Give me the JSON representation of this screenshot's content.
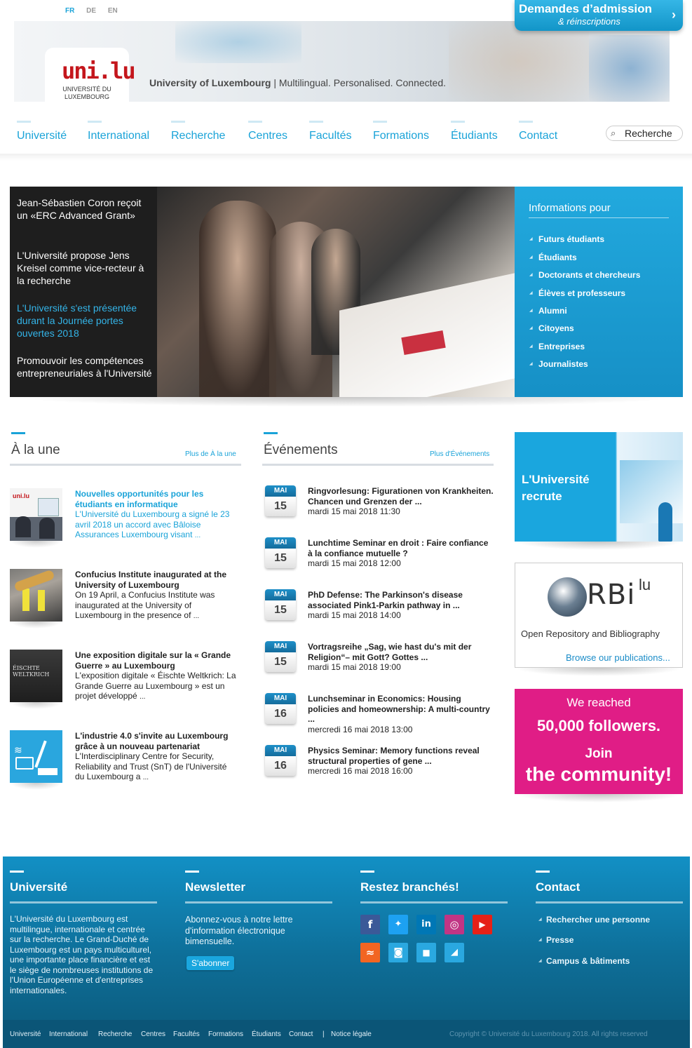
{
  "top": {
    "languages": [
      "FR",
      "DE",
      "EN"
    ],
    "active_language": "FR",
    "admission_line1": "Demandes d’admission",
    "admission_line2": "& réinscriptions",
    "admission_arrow": "›"
  },
  "brand": {
    "logo_mark": "uni.lu",
    "logo_sub": "UNIVERSITÉ DU LUXEMBOURG",
    "tagline_name": "University of Luxembourg",
    "tagline_rest": " | Multilingual. Personalised. Connected."
  },
  "nav": {
    "items": [
      "Université",
      "International",
      "Recherche",
      "Centres",
      "Facultés",
      "Formations",
      "Étudiants",
      "Contact"
    ],
    "search_value": "Recherche",
    "search_icon": "search-icon"
  },
  "slider": {
    "links": [
      "Jean-Sébastien Coron reçoit un «ERC Advanced Grant»",
      "L'Université propose Jens Kreisel comme vice-recteur à la recherche",
      "L'Université s'est présentée durant la Journée portes ouvertes 2018",
      "Promouvoir les compétences entrepreneuriales à l'Université"
    ],
    "active_index": 2
  },
  "info_panel": {
    "title": "Informations pour",
    "items": [
      "Futurs étudiants",
      "Étudiants",
      "Doctorants et chercheurs",
      "Élèves et professeurs",
      "Alumni",
      "Citoyens",
      "Entreprises",
      "Journalistes"
    ]
  },
  "news": {
    "title": "À la une",
    "more": "Plus de À la une",
    "items": [
      {
        "headline": "Nouvelles opportunités pour les étudiants en informatique",
        "body": "L'Université du Luxembourg a signé le 23 avril 2018 un accord avec Bâloise Assurances Luxembourg visant",
        "ellipsis": "..."
      },
      {
        "headline": "Confucius Institute inaugurated at the University of Luxembourg",
        "body": "On 19 April, a Confucius Institute was inaugurated at the University of Luxembourg in the presence of",
        "ellipsis": "..."
      },
      {
        "headline": "Une exposition digitale sur la « Grande Guerre » au Luxembourg",
        "body": "L'exposition digitale « Éischte Weltkrich: La Grande Guerre au Luxembourg » est un projet développé",
        "ellipsis": "..."
      },
      {
        "headline": "L'industrie 4.0 s'invite au Luxembourg grâce à un nouveau partenariat",
        "body": "L'Interdisciplinary Centre for Security, Reliability and Trust (SnT) de l'Université du Luxembourg a",
        "ellipsis": "..."
      }
    ],
    "thumb3_caption": "ÉISCHTE WELTKRICH"
  },
  "events": {
    "title": "Événements",
    "more": "Plus d'Événements",
    "items": [
      {
        "month": "MAI",
        "day": "15",
        "title": "Ringvorlesung: Figurationen von Krankheiten. Chancen und Grenzen der ...",
        "when": "mardi 15 mai 2018 11:30"
      },
      {
        "month": "MAI",
        "day": "15",
        "title": "Lunchtime Seminar en droit : Faire confiance à la confiance mutuelle ?",
        "when": "mardi 15 mai 2018 12:00"
      },
      {
        "month": "MAI",
        "day": "15",
        "title": "PhD Defense: The Parkinson's disease associated Pink1-Parkin pathway in ...",
        "when": "mardi 15 mai 2018 14:00"
      },
      {
        "month": "MAI",
        "day": "15",
        "title": "Vortragsreihe „Sag, wie hast du's mit der Religion“– mit Gott? Gottes ...",
        "when": "mardi 15 mai 2018 19:00"
      },
      {
        "month": "MAI",
        "day": "16",
        "title": "Lunchseminar in Economics: Housing policies and homeownership: A multi-country ...",
        "when": "mercredi 16 mai 2018 13:00"
      },
      {
        "month": "MAI",
        "day": "16",
        "title": "Physics Seminar: Memory functions reveal structural properties of gene ...",
        "when": "mercredi 16 mai 2018 16:00"
      }
    ]
  },
  "ads": {
    "recruit_line1": "L'Université",
    "recruit_line2": "recrute",
    "orbi_brand": "RBi",
    "orbi_sup": "lu",
    "orbi_sub": "Open Repository and Bibliography",
    "orbi_browse": "Browse our publications...",
    "social_l1": "We reached",
    "social_l2": "50,000 followers.",
    "social_l3": "Join",
    "social_l4": "the community!"
  },
  "footer": {
    "universite_title": "Université",
    "universite_text": "L'Université du Luxembourg est multilingue, internationale et centrée sur la recherche. Le Grand-Duché de Luxembourg est un pays multiculturel, une importante place financière et est le siège de nombreuses institutions de l'Union Européenne et d'entreprises internationales.",
    "newsletter_title": "Newsletter",
    "newsletter_text": "Abonnez-vous à notre lettre d'information électronique bimensuelle.",
    "subscribe": "S'abonner",
    "social_title": "Restez branchés!",
    "social_icons": [
      {
        "name": "facebook-icon",
        "glyph": "f",
        "color": "#3b5998"
      },
      {
        "name": "twitter-icon",
        "glyph": "🐦",
        "color": "#1da1f2"
      },
      {
        "name": "linkedin-icon",
        "glyph": "in",
        "color": "#0077b5"
      },
      {
        "name": "instagram-icon",
        "glyph": "◎",
        "color": "#c13584"
      },
      {
        "name": "youtube-icon",
        "glyph": "▶",
        "color": "#e62117"
      },
      {
        "name": "rss-icon",
        "glyph": "≈",
        "color": "#f26522"
      },
      {
        "name": "camera-icon",
        "glyph": "📷",
        "color": "#2aa8e0"
      },
      {
        "name": "video-icon",
        "glyph": "■",
        "color": "#2aa8e0"
      },
      {
        "name": "audio-icon",
        "glyph": "◢",
        "color": "#2aa8e0"
      }
    ],
    "contact_title": "Contact",
    "contact_links": [
      "Rechercher une personne",
      "Presse",
      "Campus & bâtiments"
    ]
  },
  "bottombar": {
    "links": [
      "Université",
      "International",
      "Recherche",
      "Centres",
      "Facultés",
      "Formations",
      "Étudiants",
      "Contact",
      "|",
      "Notice légale"
    ],
    "copyright": "Copyright © Université du Luxembourg 2018. All rights reserved"
  }
}
